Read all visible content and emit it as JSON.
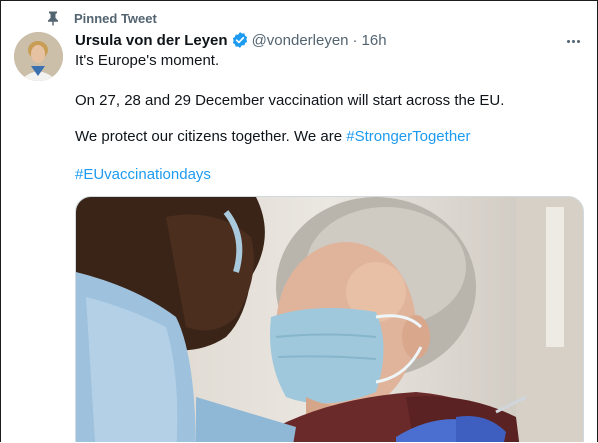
{
  "pinned": {
    "label": "Pinned Tweet",
    "icon": "pin-icon"
  },
  "author": {
    "name": "Ursula von der Leyen",
    "handle": "@vonderleyen",
    "separator": "·",
    "time": "16h",
    "verified_icon": "verified-badge-icon"
  },
  "tweet": {
    "line1": "It's Europe's moment.",
    "line2": "On 27, 28 and 29 December vaccination will start across the EU.",
    "line3_prefix": "We protect our citizens together. We are ",
    "line3_hashtag": "#StrongerTogether",
    "line4_hashtag": "#EUvaccinationdays"
  },
  "colors": {
    "link": "#1d9bf0",
    "secondary": "#536471",
    "verified": "#1d9bf0"
  }
}
